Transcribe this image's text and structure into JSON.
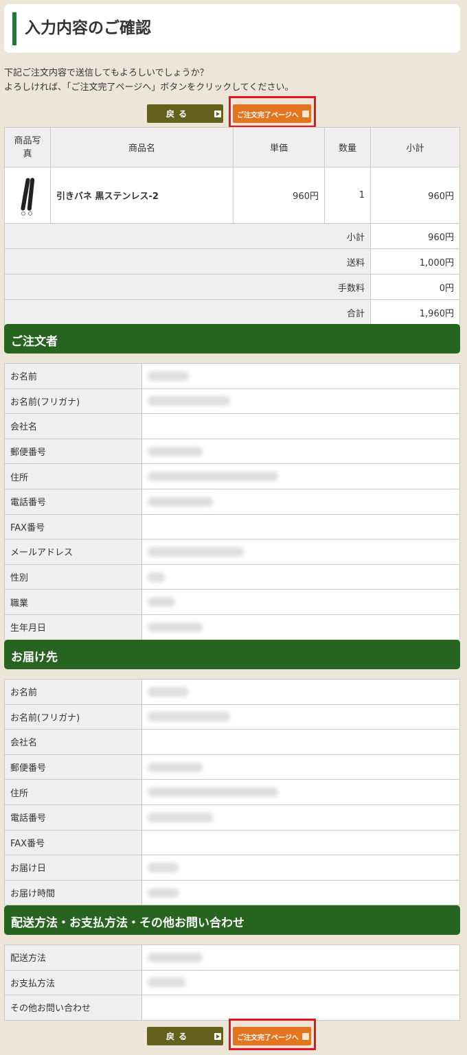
{
  "page": {
    "title": "入力内容のご確認",
    "intro_line1": "下記ご注文内容で送信してもよろしいでしょうか？",
    "intro_line2": "よろしければ、「ご注文完了ページへ」ボタンをクリックしてください。"
  },
  "buttons": {
    "back_label": "戻る",
    "confirm_label": "ご注文完了ページへ"
  },
  "cart": {
    "headers": {
      "photo": "商品写真",
      "name": "商品名",
      "unit_price": "単価",
      "quantity": "数量",
      "subtotal": "小計"
    },
    "item": {
      "name": "引きバネ 黒ステンレス-2",
      "unit_price": "960円",
      "quantity": "1",
      "subtotal": "960円"
    },
    "summary": [
      {
        "label": "小計",
        "value": "960円"
      },
      {
        "label": "送料",
        "value": "1,000円"
      },
      {
        "label": "手数料",
        "value": "0円"
      },
      {
        "label": "合計",
        "value": "1,960円"
      }
    ]
  },
  "orderer": {
    "heading": "ご注文者",
    "labels": [
      "お名前",
      "お名前(フリガナ)",
      "会社名",
      "郵便番号",
      "住所",
      "電話番号",
      "FAX番号",
      "メールアドレス",
      "性別",
      "職業",
      "生年月日"
    ]
  },
  "delivery": {
    "heading": "お届け先",
    "labels": [
      "お名前",
      "お名前(フリガナ)",
      "会社名",
      "郵便番号",
      "住所",
      "電話番号",
      "FAX番号",
      "お届け日",
      "お届け時間"
    ]
  },
  "other": {
    "heading": "配送方法・お支払方法・その他お問い合わせ",
    "labels": [
      "配送方法",
      "お支払方法",
      "その他お問い合わせ"
    ]
  },
  "colors": {
    "accent_green": "#26641f",
    "title_bar": "#1f7a3a",
    "back_button": "#66601f",
    "confirm_button": "#e37520",
    "highlight_frame": "#e8131b",
    "background": "#ede6d8"
  }
}
